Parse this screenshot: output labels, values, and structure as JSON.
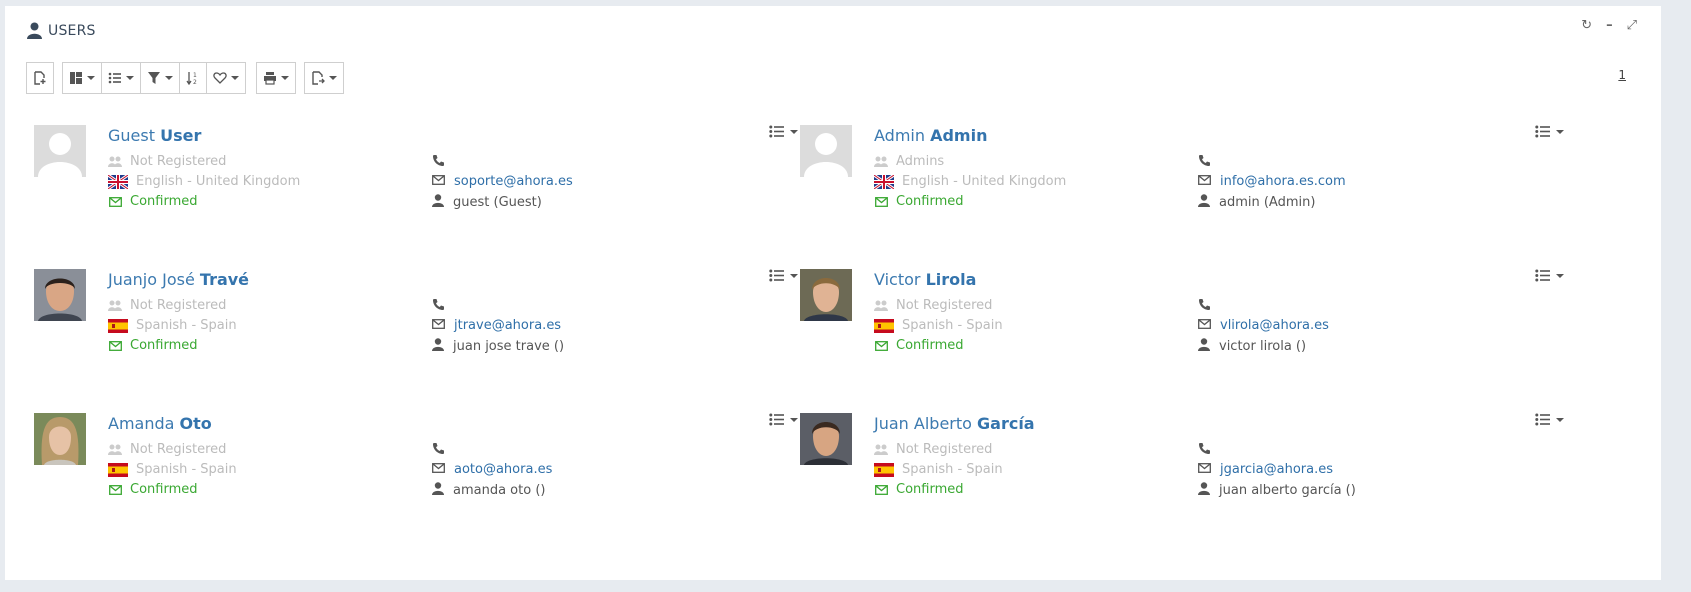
{
  "header": {
    "title": "USERS",
    "page": "1"
  },
  "toolbar": {
    "buttons": [
      "new-icon",
      "layout-icon",
      "list-icon",
      "filter-icon",
      "sort-icon",
      "favorite-icon",
      "print-icon",
      "export-icon"
    ]
  },
  "users": [
    {
      "first": "Guest",
      "last": "User",
      "group": "Not Registered",
      "language": "English - United Kingdom",
      "flag": "uk",
      "status": "Confirmed",
      "phone": "",
      "email": "soporte@ahora.es",
      "login": "guest (Guest)",
      "avatar": "placeholder"
    },
    {
      "first": "Admin",
      "last": "Admin",
      "group": "Admins",
      "language": "English - United Kingdom",
      "flag": "uk",
      "status": "Confirmed",
      "phone": "",
      "email": "info@ahora.es.com",
      "login": "admin (Admin)",
      "avatar": "placeholder"
    },
    {
      "first": "Juanjo José",
      "last": "Travé",
      "group": "Not Registered",
      "language": "Spanish - Spain",
      "flag": "es",
      "status": "Confirmed",
      "phone": "",
      "email": "jtrave@ahora.es",
      "login": "juan jose trave ()",
      "avatar": "photo"
    },
    {
      "first": "Victor",
      "last": "Lirola",
      "group": "Not Registered",
      "language": "Spanish - Spain",
      "flag": "es",
      "status": "Confirmed",
      "phone": "",
      "email": "vlirola@ahora.es",
      "login": "victor lirola ()",
      "avatar": "photo"
    },
    {
      "first": "Amanda",
      "last": "Oto",
      "group": "Not Registered",
      "language": "Spanish - Spain",
      "flag": "es",
      "status": "Confirmed",
      "phone": "",
      "email": "aoto@ahora.es",
      "login": "amanda oto ()",
      "avatar": "photo"
    },
    {
      "first": "Juan Alberto",
      "last": "García",
      "group": "Not Registered",
      "language": "Spanish - Spain",
      "flag": "es",
      "status": "Confirmed",
      "phone": "",
      "email": "jgarcia@ahora.es",
      "login": "juan alberto garcía ()",
      "avatar": "photo"
    }
  ],
  "colors": {
    "link": "#2f6fa8",
    "confirmed": "#3aa832",
    "muted": "#bbbbbb"
  }
}
